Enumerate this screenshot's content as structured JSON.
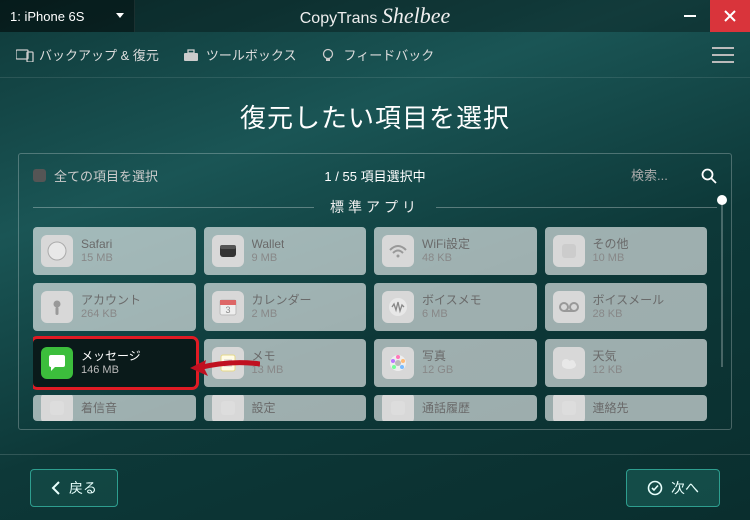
{
  "titlebar": {
    "device": "1: iPhone 6S",
    "app_name": "CopyTrans",
    "app_suffix": "Shelbee"
  },
  "toolbar": {
    "backup_restore": "バックアップ & 復元",
    "toolbox": "ツールボックス",
    "feedback": "フィードバック"
  },
  "heading": "復元したい項目を選択",
  "panel": {
    "select_all": "全ての項目を選択",
    "count": "1 / 55 項目選択中",
    "search_placeholder": "検索...",
    "section": "標準アプリ"
  },
  "tiles": [
    {
      "name": "Safari",
      "size": "15 MB"
    },
    {
      "name": "Wallet",
      "size": "9 MB"
    },
    {
      "name": "WiFi設定",
      "size": "48 KB"
    },
    {
      "name": "その他",
      "size": "10 MB"
    },
    {
      "name": "アカウント",
      "size": "264 KB"
    },
    {
      "name": "カレンダー",
      "size": "2 MB"
    },
    {
      "name": "ボイスメモ",
      "size": "6 MB"
    },
    {
      "name": "ボイスメール",
      "size": "28 KB"
    },
    {
      "name": "メッセージ",
      "size": "146 MB"
    },
    {
      "name": "メモ",
      "size": "13 MB"
    },
    {
      "name": "写真",
      "size": "12 GB"
    },
    {
      "name": "天気",
      "size": "12 KB"
    },
    {
      "name": "着信音",
      "size": ""
    },
    {
      "name": "設定",
      "size": ""
    },
    {
      "name": "通話履歴",
      "size": ""
    },
    {
      "name": "連絡先",
      "size": ""
    }
  ],
  "footer": {
    "back": "戻る",
    "next": "次へ"
  }
}
